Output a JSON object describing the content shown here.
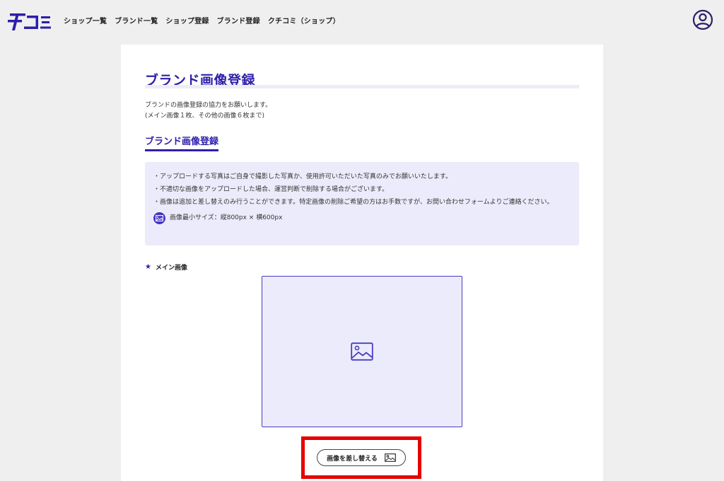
{
  "header": {
    "nav": [
      "ショップ一覧",
      "ブランド一覧",
      "ショップ登録",
      "ブランド登録",
      "クチコミ（ショップ）"
    ]
  },
  "page": {
    "title": "ブランド画像登録",
    "intro_line1": "ブランドの画像登録の協力をお願いします。",
    "intro_line2": "(メイン画像１枚、その他の画像６枚まで)",
    "section_title": "ブランド画像登録"
  },
  "notice": {
    "line1": "・アップロードする写真はご自身で撮影した写真か、使用許可いただいた写真のみでお願いいたします。",
    "line2": "・不適切な画像をアップロードした場合、運営判断で削除する場合がございます。",
    "line3": "・画像は追加と差し替えのみ行うことができます。特定画像の削除ご希望の方はお手数ですが、お問い合わせフォームよりご連絡ください。",
    "size_text": "画像最小サイズ：縦800px × 横600px"
  },
  "main_image": {
    "label": "メイン画像",
    "replace_label": "画像を差し替える"
  },
  "colors": {
    "accent": "#2d1fa8",
    "notice_bg": "#ecebfb",
    "highlight": "#e60000"
  }
}
